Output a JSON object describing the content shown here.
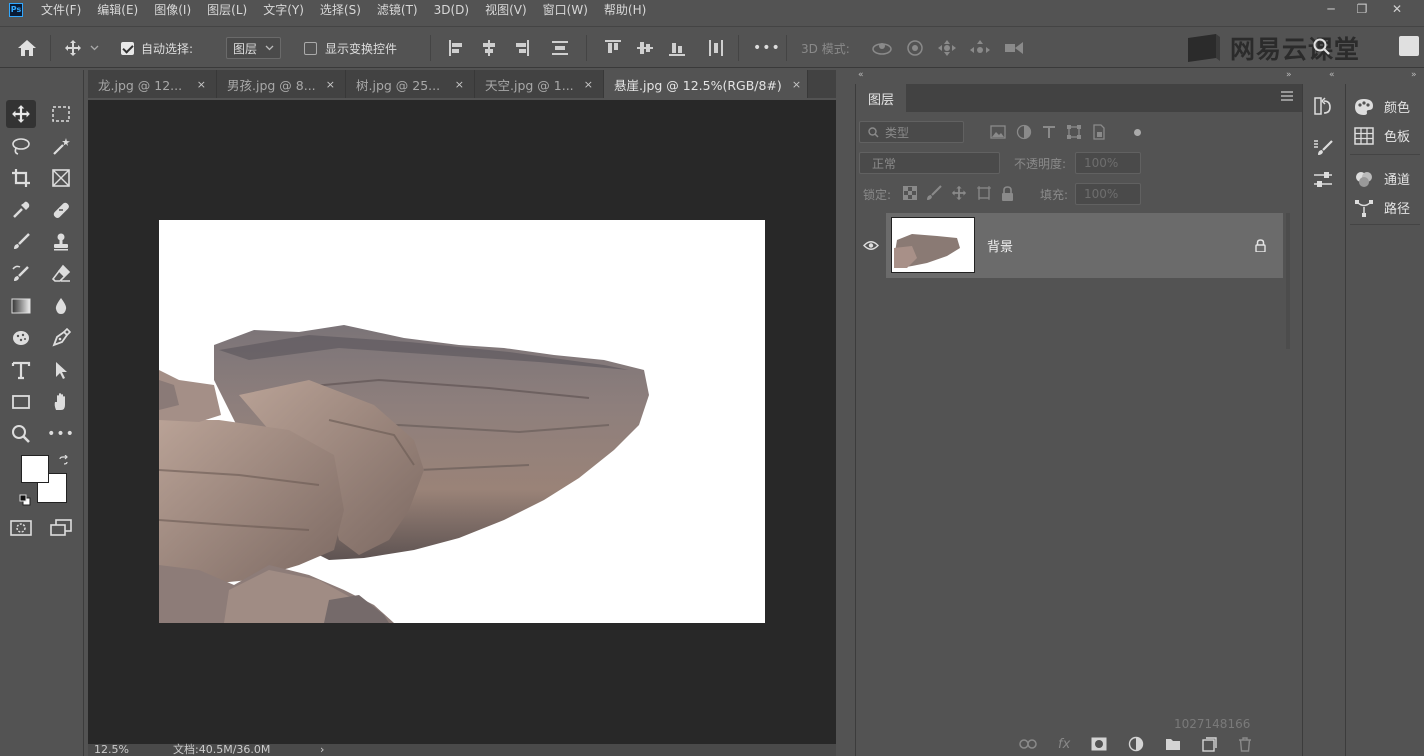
{
  "app": {
    "logo": "Ps"
  },
  "menu": [
    "文件(F)",
    "编辑(E)",
    "图像(I)",
    "图层(L)",
    "文字(Y)",
    "选择(S)",
    "滤镜(T)",
    "3D(D)",
    "视图(V)",
    "窗口(W)",
    "帮助(H)"
  ],
  "window_controls": {
    "minimize": "─",
    "restore": "❐",
    "close": "✕"
  },
  "options": {
    "auto_select_label": "自动选择:",
    "auto_select_checked": true,
    "auto_select_target": "图层",
    "show_transform_label": "显示变换控件",
    "show_transform_checked": false,
    "more": "•••",
    "mode_3d_label": "3D 模式:"
  },
  "watermark": {
    "text": "网易云课堂"
  },
  "tabs": [
    {
      "label": "龙.jpg @ 12...",
      "close": "×",
      "active": false
    },
    {
      "label": "男孩.jpg @ 8...",
      "close": "×",
      "active": false
    },
    {
      "label": "树.jpg @ 25...",
      "close": "×",
      "active": false
    },
    {
      "label": "天空.jpg @ 1...",
      "close": "×",
      "active": false
    },
    {
      "label": "悬崖.jpg @ 12.5%(RGB/8#)",
      "close": "×",
      "active": true
    }
  ],
  "tools": [
    "move-tool",
    "marquee-tool",
    "lasso-tool",
    "magic-wand-tool",
    "crop-tool",
    "frame-tool",
    "eyedropper-tool",
    "healing-tool",
    "brush-tool",
    "stamp-tool",
    "history-brush-tool",
    "eraser-tool",
    "gradient-tool",
    "blur-tool",
    "dodge-tool",
    "pen-tool",
    "type-tool",
    "path-select-tool",
    "rectangle-tool",
    "hand-tool",
    "zoom-tool",
    "more-tools"
  ],
  "colors": {
    "foreground": "#ffffff",
    "background": "#ffffff",
    "accent": "#31a8ff"
  },
  "status": {
    "zoom": "12.5%",
    "doc_info": "文档:40.5M/36.0M",
    "arrow": "›"
  },
  "layers_panel": {
    "title": "图层",
    "filter_placeholder": "类型",
    "blend_mode": "正常",
    "opacity_label": "不透明度:",
    "opacity_value": "100%",
    "lock_label": "锁定:",
    "fill_label": "填充:",
    "fill_value": "100%",
    "layers": [
      {
        "name": "背景",
        "visible": true,
        "locked": true
      }
    ],
    "footer_id": "1027148166"
  },
  "right_panels": [
    {
      "label": "颜色",
      "icon": "palette-icon"
    },
    {
      "label": "色板",
      "icon": "swatches-icon"
    },
    {
      "label": "通道",
      "icon": "channels-icon"
    },
    {
      "label": "路径",
      "icon": "paths-icon"
    }
  ]
}
